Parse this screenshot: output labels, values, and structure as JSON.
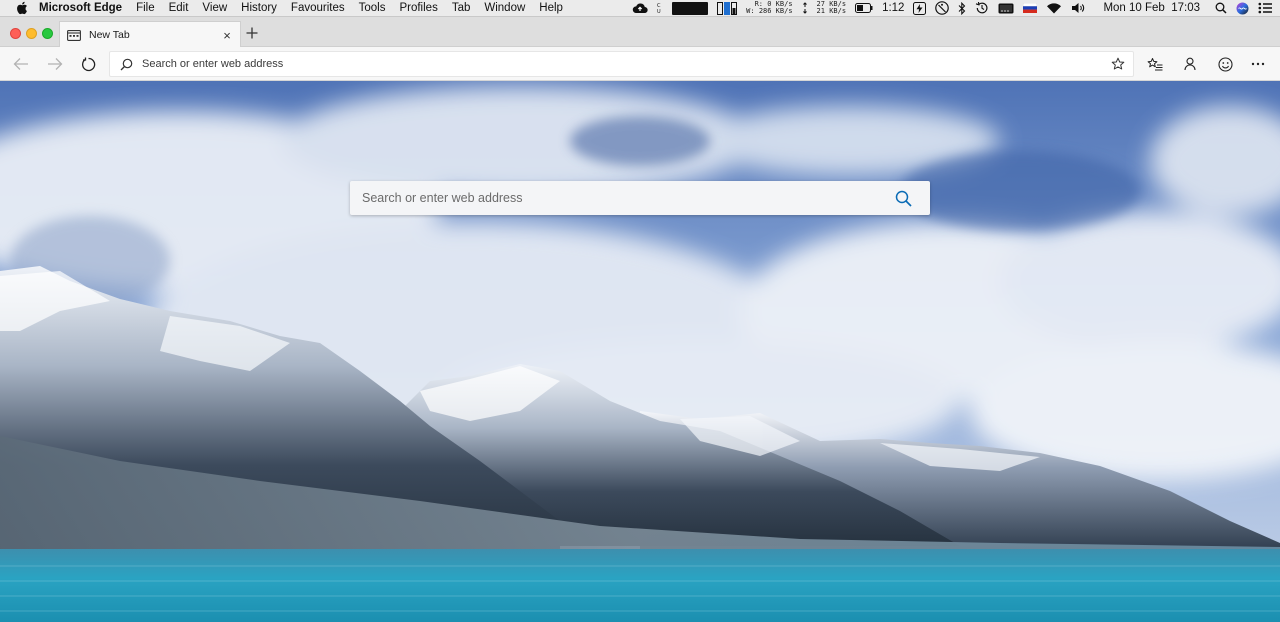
{
  "menubar": {
    "app_name": "Microsoft Edge",
    "items": [
      "File",
      "Edit",
      "View",
      "History",
      "Favourites",
      "Tools",
      "Profiles",
      "Tab",
      "Window",
      "Help"
    ],
    "net_stats": {
      "read_label": "R:",
      "write_label": "W:",
      "read_rate": "0 KB/s",
      "write_rate": "286 KB/s",
      "down_rate": "27 KB/s",
      "up_rate": "21 KB/s"
    },
    "battery_time": "1:12",
    "datetime": "Mon 10 Feb  17:03"
  },
  "tab": {
    "title": "New Tab",
    "close_glyph": "×",
    "new_tab_glyph": "+"
  },
  "address_bar": {
    "placeholder": "Search or enter web address",
    "value": ""
  },
  "page": {
    "search_placeholder": "Search or enter web address",
    "search_value": ""
  },
  "colors": {
    "accent": "#0a6bb5",
    "tab_active_bg": "#f7f7f7",
    "tabstrip_bg": "#dedede",
    "toolbar_bg": "#f7f7f7",
    "sky": "#6f8fc8",
    "water": "#2a9fbf"
  },
  "icons": {
    "apple": "apple-logo-icon",
    "back": "back-arrow-icon",
    "forward": "forward-arrow-icon",
    "refresh": "refresh-icon",
    "search": "search-icon",
    "favorite": "star-icon",
    "favorites_hub": "favorites-list-icon",
    "profile": "profile-icon",
    "feedback": "smiley-icon",
    "more": "more-dots-icon"
  }
}
